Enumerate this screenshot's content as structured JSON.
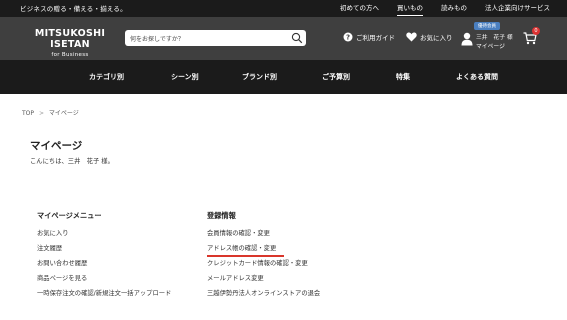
{
  "topbar": {
    "tagline": "ビジネスの贈る・備える・揃える。",
    "links": [
      {
        "label": "初めての方へ",
        "active": false
      },
      {
        "label": "買いもの",
        "active": true
      },
      {
        "label": "読みもの",
        "active": false
      },
      {
        "label": "法人企業向けサービス",
        "active": false
      }
    ]
  },
  "header": {
    "logo_main": "MITSUKOSHI ISETAN",
    "logo_sub": "for Business",
    "search_placeholder": "何をお探しですか？",
    "guide_label": "ご利用ガイド",
    "favorite_label": "お気に入り",
    "member_badge": "優待会員",
    "member_name": "三井　花子 様",
    "mypage_label": "マイページ",
    "cart_count": "0"
  },
  "nav": {
    "items": [
      "カテゴリ別",
      "シーン別",
      "ブランド別",
      "ご予算別",
      "特集",
      "よくある質問"
    ]
  },
  "breadcrumb": {
    "top": "TOP",
    "sep": ">",
    "current": "マイページ"
  },
  "page": {
    "title": "マイページ",
    "greeting": "こんにちは、三井　花子 様。"
  },
  "menu": {
    "heading": "マイページメニュー",
    "items": [
      "お気に入り",
      "注文履歴",
      "お問い合わせ履歴",
      "商品ページを見る",
      "一時保存注文の確認/新規注文一括アップロード"
    ]
  },
  "registration": {
    "heading": "登録情報",
    "items": [
      "会員情報の確認・変更",
      "アドレス帳の確認・変更",
      "クレジットカード情報の確認・変更",
      "メールアドレス変更",
      "三越伊勢丹法人オンラインストアの退会"
    ]
  },
  "colors": {
    "topbar": "#1b1b1b",
    "header": "#3f3f3f",
    "accent_underline": "#d9362b",
    "badge": "#4a7fc0"
  }
}
